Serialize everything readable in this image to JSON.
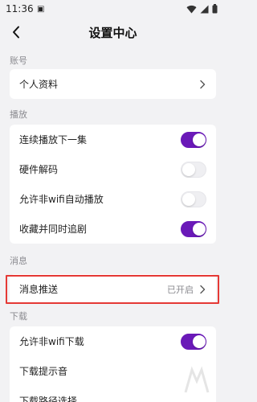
{
  "status_bar": {
    "time": "11:36"
  },
  "header": {
    "title": "设置中心"
  },
  "sections": {
    "account": {
      "label": "账号",
      "items": {
        "profile": {
          "label": "个人资料"
        }
      }
    },
    "playback": {
      "label": "播放",
      "items": {
        "autoplay_next": {
          "label": "连续播放下一集",
          "enabled": true
        },
        "hw_decode": {
          "label": "硬件解码",
          "enabled": false
        },
        "non_wifi_autoplay": {
          "label": "允许非wifi自动播放",
          "enabled": false
        },
        "collect_follow": {
          "label": "收藏并同时追剧",
          "enabled": true
        }
      }
    },
    "messages": {
      "label": "消息",
      "items": {
        "push": {
          "label": "消息推送",
          "value": "已开启"
        }
      }
    },
    "download": {
      "label": "下载",
      "items": {
        "non_wifi_download": {
          "label": "允许非wifi下载",
          "enabled": true
        },
        "download_sound": {
          "label": "下载提示音"
        },
        "download_path": {
          "label": "下载路径选择"
        }
      }
    }
  },
  "colors": {
    "accent": "#6a19b8",
    "highlight": "#e53935",
    "background": "#f2f2f4"
  }
}
